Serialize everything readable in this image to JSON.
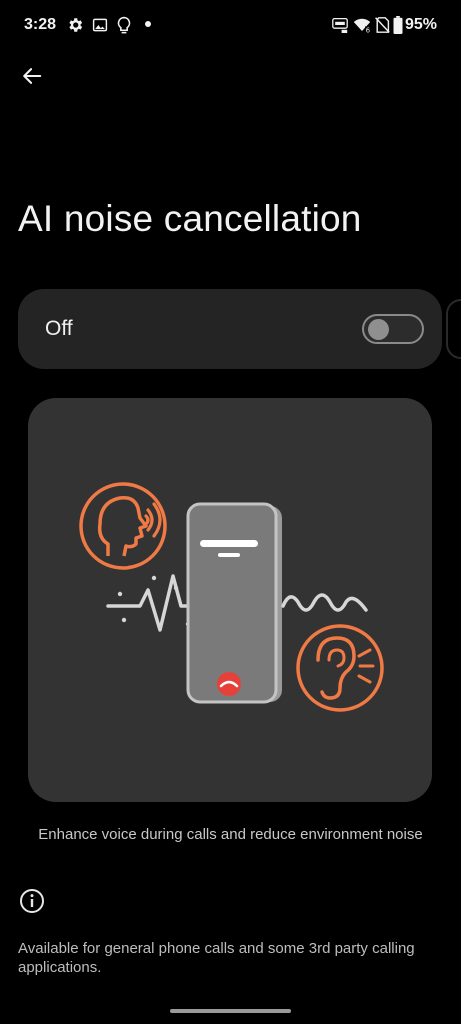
{
  "status_bar": {
    "time": "3:28",
    "battery_percent": "95%",
    "icons": [
      "settings-icon",
      "gallery-icon",
      "lightbulb-icon",
      "dot-icon",
      "auto-brightness-icon",
      "wifi-icon",
      "no-sim-icon",
      "battery-icon"
    ]
  },
  "header": {
    "back_icon": "arrow-left-icon",
    "title": "AI noise cancellation"
  },
  "toggle": {
    "label": "Off",
    "state": false
  },
  "illustration": {
    "accent_color": "#f07a45",
    "decline_color": "#e5413a",
    "icons": [
      "speaking-head-icon",
      "phone-icon",
      "ear-icon",
      "end-call-icon"
    ]
  },
  "caption": "Enhance voice during calls and reduce environment noise",
  "info": {
    "icon": "info-icon",
    "text": "Available for general phone calls and some 3rd party calling applications."
  },
  "colors": {
    "background": "#000000",
    "card": "#242424",
    "illustration_bg": "#333333"
  }
}
